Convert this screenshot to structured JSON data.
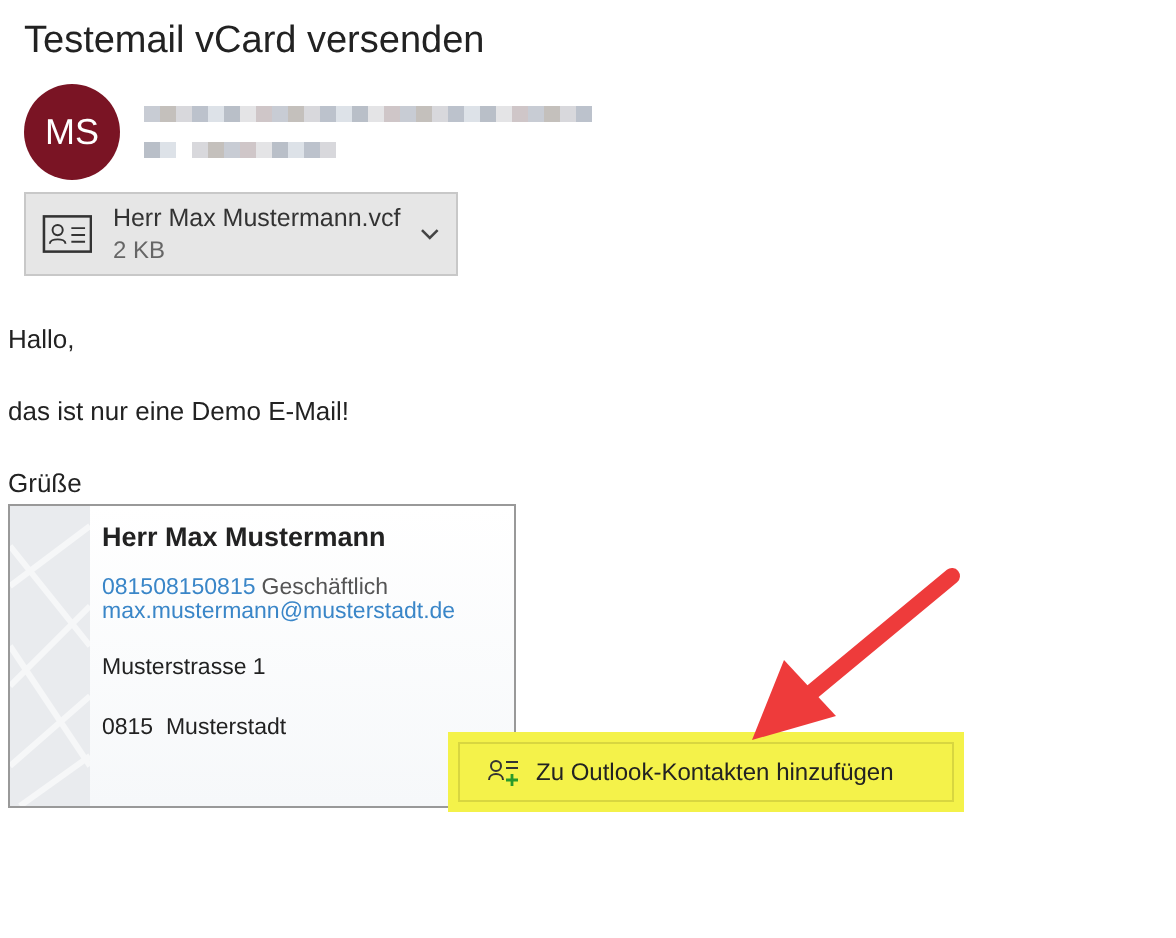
{
  "message": {
    "subject": "Testemail vCard versenden",
    "avatar_initials": "MS"
  },
  "attachment": {
    "filename": "Herr Max Mustermann.vcf",
    "size": "2 KB"
  },
  "body": [
    "Hallo,",
    "das ist nur eine Demo E-Mail!",
    "Grüße"
  ],
  "contact_card": {
    "name": "Herr Max Mustermann",
    "phone": "081508150815",
    "phone_type": "Geschäftlich",
    "email": "max.mustermann@musterstadt.de",
    "street": "Musterstrasse 1",
    "city": "0815  Musterstadt"
  },
  "popup_action": {
    "label": "Zu Outlook-Kontakten hinzufügen"
  }
}
